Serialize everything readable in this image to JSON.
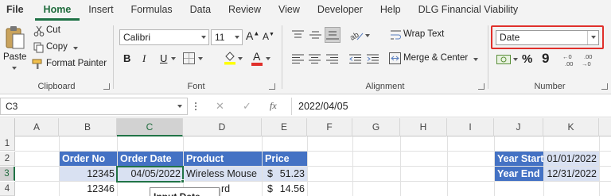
{
  "menu": {
    "items": [
      "File",
      "Home",
      "Insert",
      "Formulas",
      "Data",
      "Review",
      "View",
      "Developer",
      "Help",
      "DLG Financial Viability"
    ],
    "active": "Home"
  },
  "ribbon": {
    "clipboard": {
      "label": "Clipboard",
      "paste": "Paste",
      "cut": "Cut",
      "copy": "Copy",
      "format_painter": "Format Painter"
    },
    "font": {
      "label": "Font",
      "font_name": "Calibri",
      "font_size": "11",
      "grow": "A",
      "shrink": "A",
      "bold": "B",
      "italic": "I",
      "underline": "U",
      "font_color_letter": "A"
    },
    "alignment": {
      "label": "Alignment",
      "wrap_text": "Wrap Text",
      "merge_center": "Merge & Center"
    },
    "number": {
      "label": "Number",
      "format_value": "Date",
      "percent": "%",
      "comma": "9"
    }
  },
  "formula_bar": {
    "name_box": "C3",
    "fx": "fx",
    "cancel": "✕",
    "enter": "✓",
    "formula": "2022/04/05"
  },
  "grid": {
    "columns": [
      "A",
      "B",
      "C",
      "D",
      "E",
      "F",
      "G",
      "H",
      "I",
      "J",
      "K"
    ],
    "rows": [
      "1",
      "2",
      "3",
      "4"
    ],
    "table_header": [
      "Order No",
      "Order Date",
      "Product",
      "Price"
    ],
    "rows_data": [
      {
        "order_no": "12345",
        "order_date": "04/05/2022",
        "product": "Wireless Mouse",
        "currency": "$",
        "price": "51.23"
      },
      {
        "order_no": "12346",
        "order_date": "",
        "product": "rd",
        "currency": "$",
        "price": "14.56"
      }
    ],
    "side_table": [
      {
        "label": "Year Start",
        "value": "01/01/2022"
      },
      {
        "label": "Year End",
        "value": "12/31/2022"
      }
    ],
    "tooltip": "Input Date"
  },
  "colors": {
    "accent_green": "#217346",
    "table_header_blue": "#4472c4",
    "selected_row": "#d9e1f2",
    "highlight_red": "#e0302b"
  }
}
